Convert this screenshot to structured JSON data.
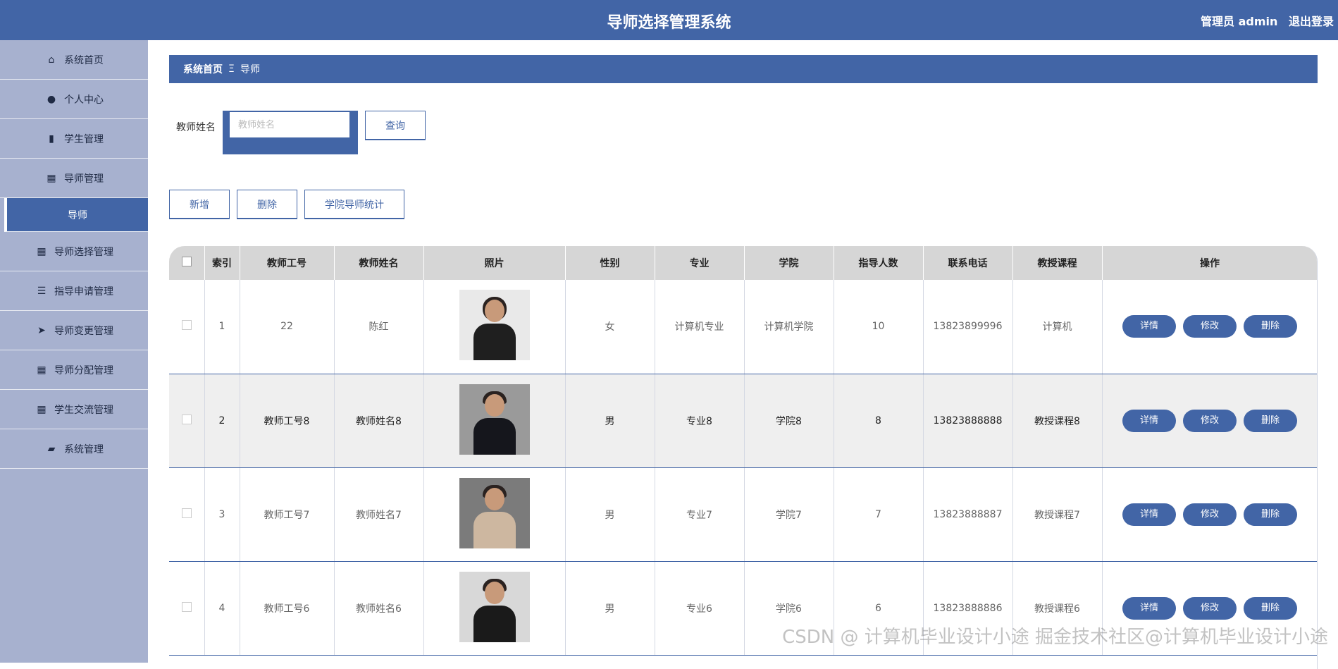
{
  "header": {
    "title": "导师选择管理系统",
    "user_label": "管理员 admin",
    "logout_label": "退出登录"
  },
  "sidebar": {
    "items": [
      {
        "label": "系统首页",
        "icon": "home-icon"
      },
      {
        "label": "个人中心",
        "icon": "user-icon"
      },
      {
        "label": "学生管理",
        "icon": "book-icon"
      },
      {
        "label": "导师管理",
        "icon": "grid-icon"
      },
      {
        "label": "导师",
        "icon": "",
        "active": true
      },
      {
        "label": "导师选择管理",
        "icon": "grid-icon"
      },
      {
        "label": "指导申请管理",
        "icon": "list-icon"
      },
      {
        "label": "导师变更管理",
        "icon": "send-icon"
      },
      {
        "label": "导师分配管理",
        "icon": "grid-icon"
      },
      {
        "label": "学生交流管理",
        "icon": "grid-icon"
      },
      {
        "label": "系统管理",
        "icon": "briefcase-icon"
      }
    ]
  },
  "breadcrumb": {
    "home": "系统首页",
    "separator": "Ξ",
    "current": "导师"
  },
  "search": {
    "label": "教师姓名",
    "placeholder": "教师姓名",
    "value": "",
    "button": "查询"
  },
  "actions": {
    "add": "新增",
    "delete": "删除",
    "stats": "学院导师统计"
  },
  "table": {
    "columns": [
      "索引",
      "教师工号",
      "教师姓名",
      "照片",
      "性别",
      "专业",
      "学院",
      "指导人数",
      "联系电话",
      "教授课程",
      "操作"
    ],
    "rows": [
      {
        "index": "1",
        "id": "22",
        "name": "陈红",
        "gender": "女",
        "major": "计算机专业",
        "college": "计算机学院",
        "count": "10",
        "phone": "13823899996",
        "course": "计算机"
      },
      {
        "index": "2",
        "id": "教师工号8",
        "name": "教师姓名8",
        "gender": "男",
        "major": "专业8",
        "college": "学院8",
        "count": "8",
        "phone": "13823888888",
        "course": "教授课程8"
      },
      {
        "index": "3",
        "id": "教师工号7",
        "name": "教师姓名7",
        "gender": "男",
        "major": "专业7",
        "college": "学院7",
        "count": "7",
        "phone": "13823888887",
        "course": "教授课程7"
      },
      {
        "index": "4",
        "id": "教师工号6",
        "name": "教师姓名6",
        "gender": "男",
        "major": "专业6",
        "college": "学院6",
        "count": "6",
        "phone": "13823888886",
        "course": "教授课程6"
      }
    ],
    "row_actions": {
      "detail": "详情",
      "edit": "修改",
      "delete": "删除"
    }
  },
  "watermark": "CSDN @ 计算机毕业设计小途 掘金技术社区@计算机毕业设计小途",
  "colors": {
    "primary": "#4265a6",
    "sidebar": "#a7b1cf",
    "header_row": "#d6d6d6"
  }
}
